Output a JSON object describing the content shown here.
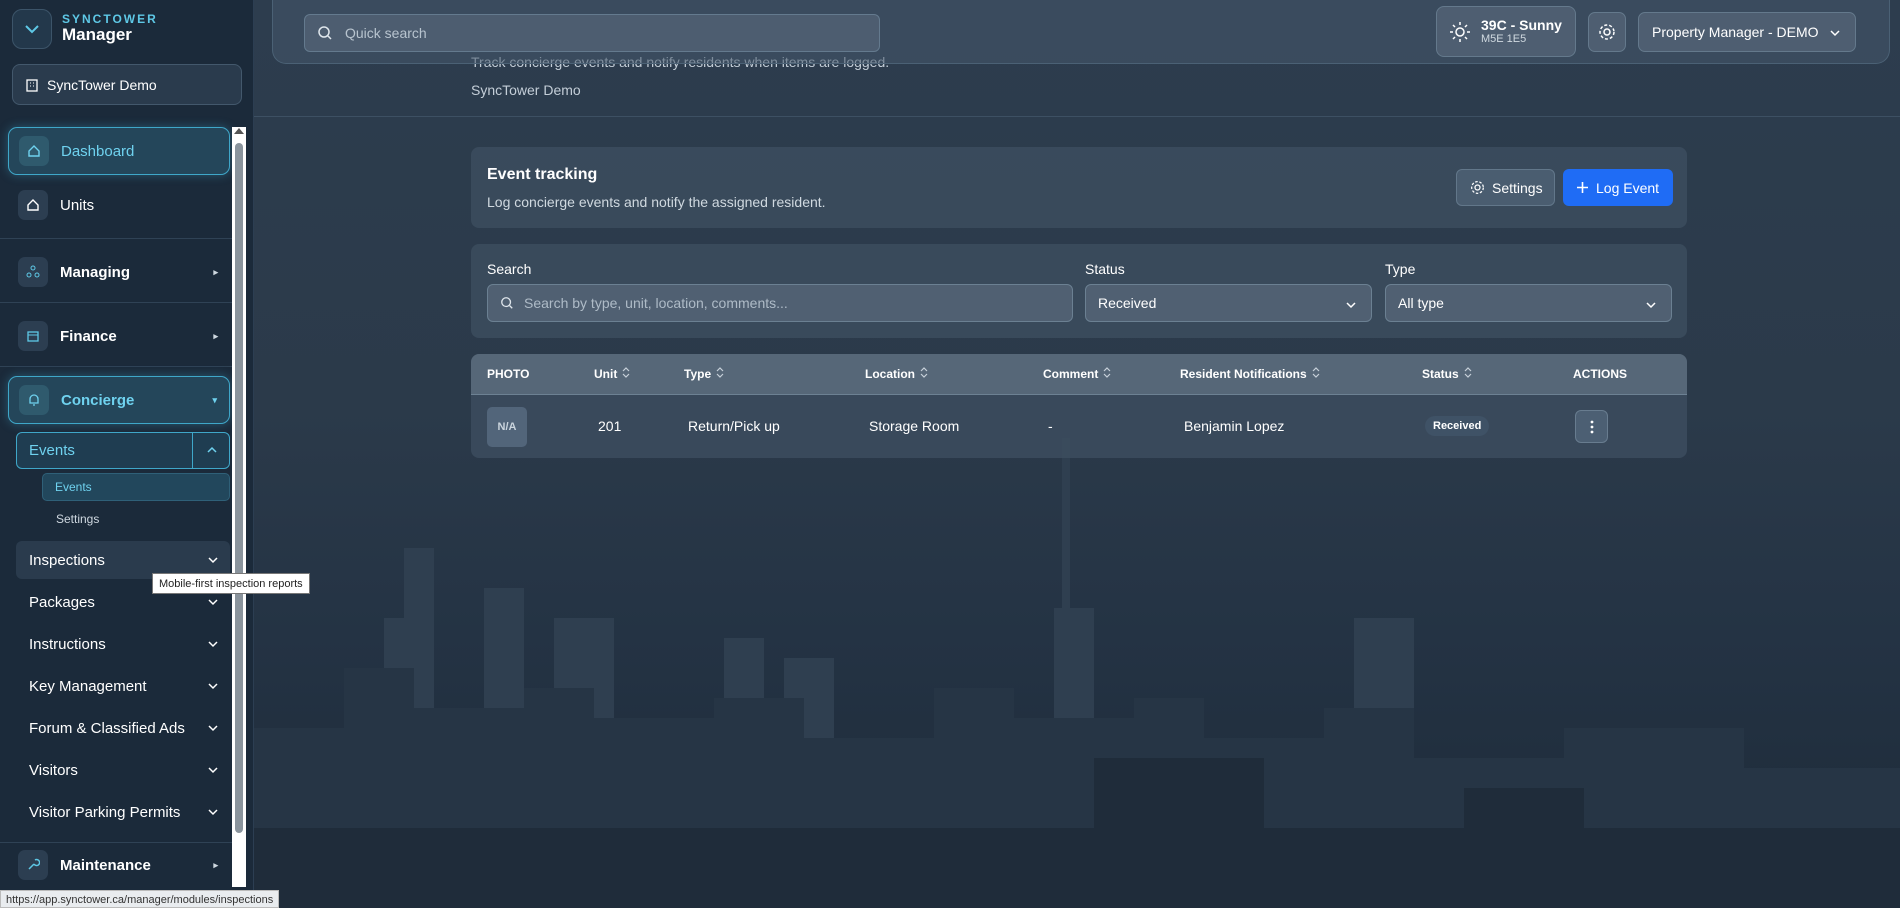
{
  "brand": {
    "top": "SYNCTOWER",
    "bottom": "Manager"
  },
  "org_button": {
    "label": "SyncTower Demo",
    "icon": "building-icon"
  },
  "sidebar": {
    "dashboard": "Dashboard",
    "units": "Units",
    "managing": "Managing",
    "finance": "Finance",
    "concierge": "Concierge",
    "concierge_sub": {
      "events_group": "Events",
      "events_link": "Events",
      "settings_link": "Settings"
    },
    "groups": [
      "Inspections",
      "Packages",
      "Instructions",
      "Key Management",
      "Forum & Classified Ads",
      "Visitors",
      "Visitor Parking Permits"
    ],
    "maintenance": "Maintenance"
  },
  "tooltip": "Mobile-first inspection reports",
  "status_url": "https://app.synctower.ca/manager/modules/inspections",
  "topbar": {
    "search_placeholder": "Quick search",
    "weather_title": "39C - Sunny",
    "weather_postal": "M5E 1E5",
    "user_label": "Property Manager - DEMO"
  },
  "page": {
    "subtitle": "Track concierge events and notify residents when items are logged.",
    "org": "SyncTower Demo"
  },
  "event_card": {
    "title": "Event tracking",
    "description": "Log concierge events and notify the assigned resident.",
    "settings_label": "Settings",
    "log_label": "Log Event"
  },
  "filters": {
    "search_label": "Search",
    "search_placeholder": "Search by type, unit, location, comments...",
    "status_label": "Status",
    "status_value": "Received",
    "type_label": "Type",
    "type_value": "All type"
  },
  "table": {
    "headers": [
      "PHOTO",
      "Unit",
      "Type",
      "Location",
      "Comment",
      "Resident Notifications",
      "Status",
      "ACTIONS"
    ],
    "rows": [
      {
        "photo": "N/A",
        "unit": "201",
        "type": "Return/Pick up",
        "location": "Storage Room",
        "comment": "-",
        "resident": "Benjamin Lopez",
        "status": "Received"
      }
    ]
  },
  "colors": {
    "accent": "#5ec8e6",
    "primary_button": "#1f6cf5",
    "sidebar_bg": "#1b2a3a"
  }
}
